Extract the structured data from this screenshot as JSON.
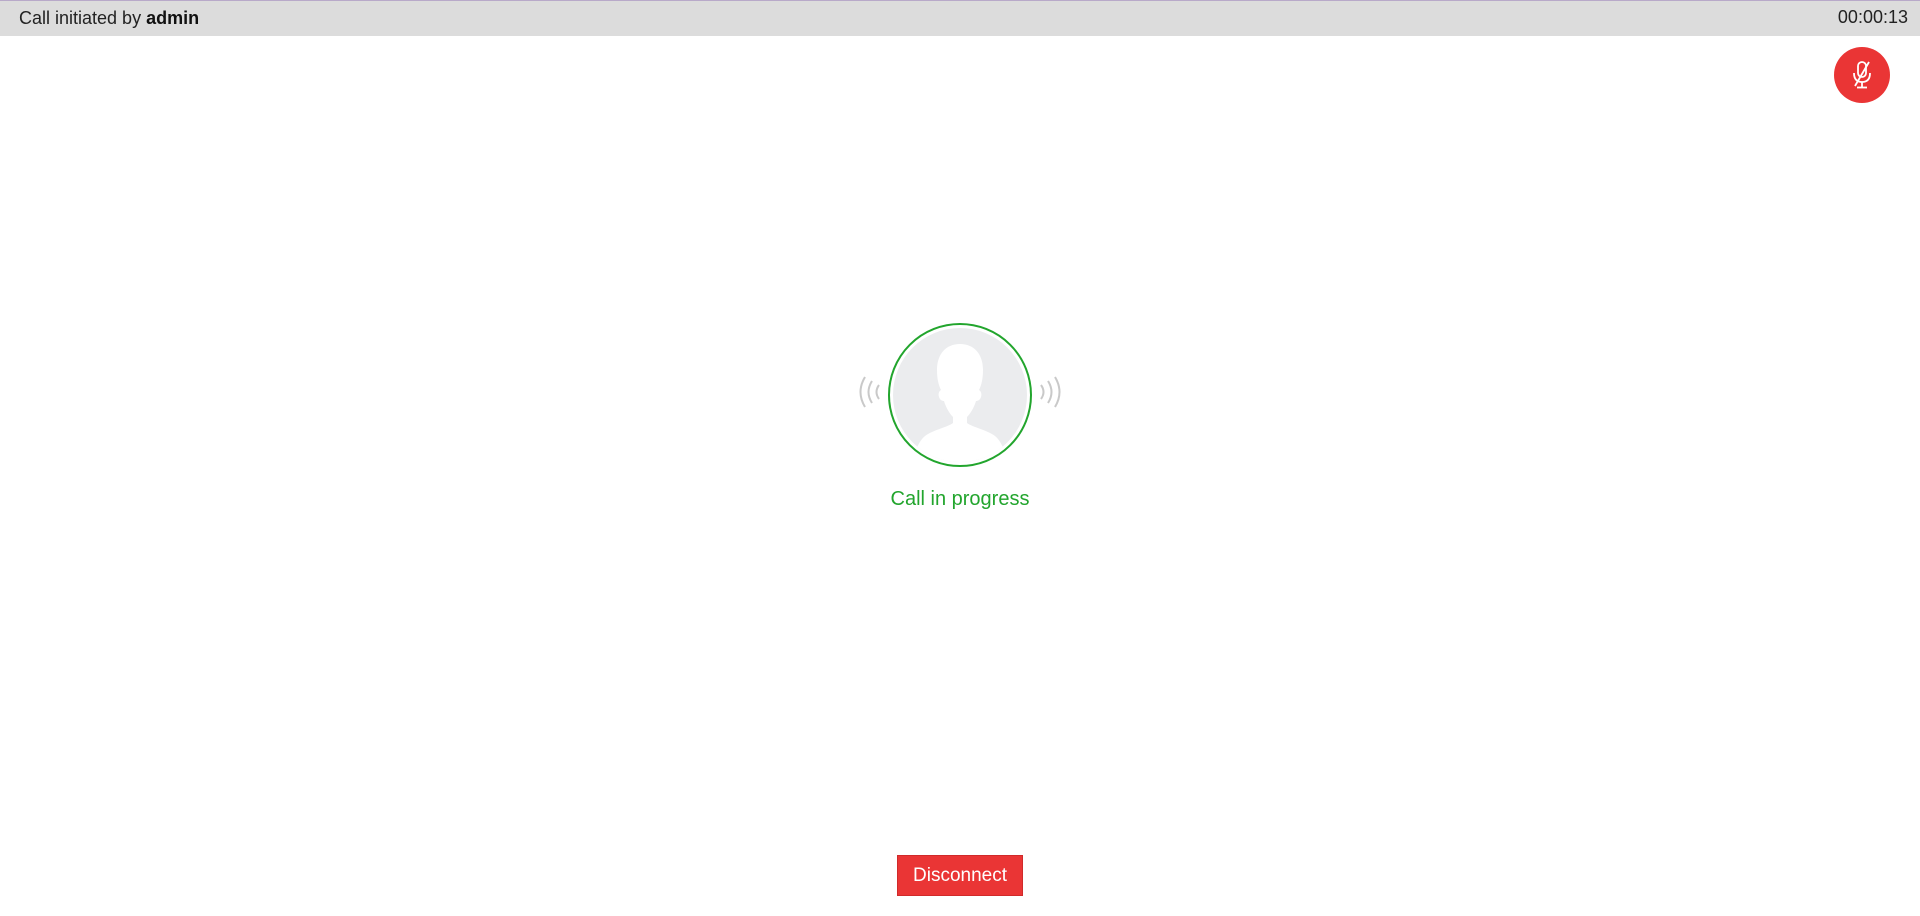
{
  "header": {
    "initiated_prefix": "Call initiated by ",
    "initiator": "admin",
    "timer": "00:00:13"
  },
  "call": {
    "status": "Call in progress"
  },
  "controls": {
    "disconnect_label": "Disconnect",
    "mute_icon": "microphone-muted-icon"
  },
  "colors": {
    "accent_red": "#ea3535",
    "status_green": "#22a52d",
    "topbar_bg": "#dcdcdc"
  }
}
